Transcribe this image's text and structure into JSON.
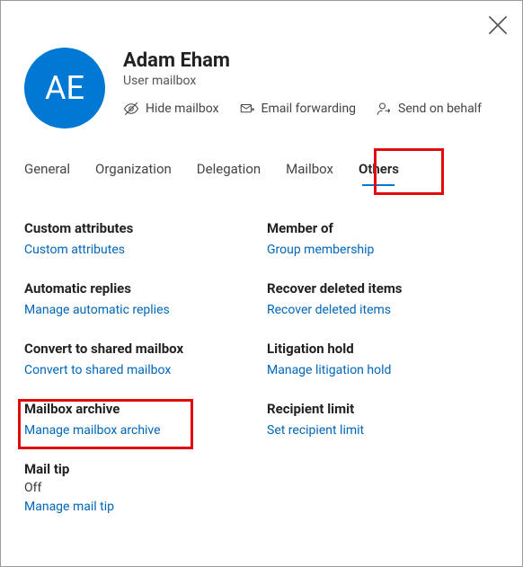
{
  "header": {
    "avatar_initials": "AE",
    "title": "Adam Eham",
    "subtitle": "User mailbox",
    "actions": {
      "hide_mailbox": "Hide mailbox",
      "email_forwarding": "Email forwarding",
      "send_on_behalf": "Send on behalf"
    }
  },
  "tabs": {
    "general": "General",
    "organization": "Organization",
    "delegation": "Delegation",
    "mailbox": "Mailbox",
    "others": "Others"
  },
  "sections": {
    "custom_attributes": {
      "title": "Custom attributes",
      "link": "Custom attributes"
    },
    "member_of": {
      "title": "Member of",
      "link": "Group membership"
    },
    "automatic_replies": {
      "title": "Automatic replies",
      "link": "Manage automatic replies"
    },
    "recover_deleted": {
      "title": "Recover deleted items",
      "link": "Recover deleted items"
    },
    "convert_shared": {
      "title": "Convert to shared mailbox",
      "link": "Convert to shared mailbox"
    },
    "litigation_hold": {
      "title": "Litigation hold",
      "link": "Manage litigation hold"
    },
    "mailbox_archive": {
      "title": "Mailbox archive",
      "link": "Manage mailbox archive"
    },
    "recipient_limit": {
      "title": "Recipient limit",
      "link": "Set recipient limit"
    },
    "mail_tip": {
      "title": "Mail tip",
      "value": "Off",
      "link": "Manage mail tip"
    }
  }
}
